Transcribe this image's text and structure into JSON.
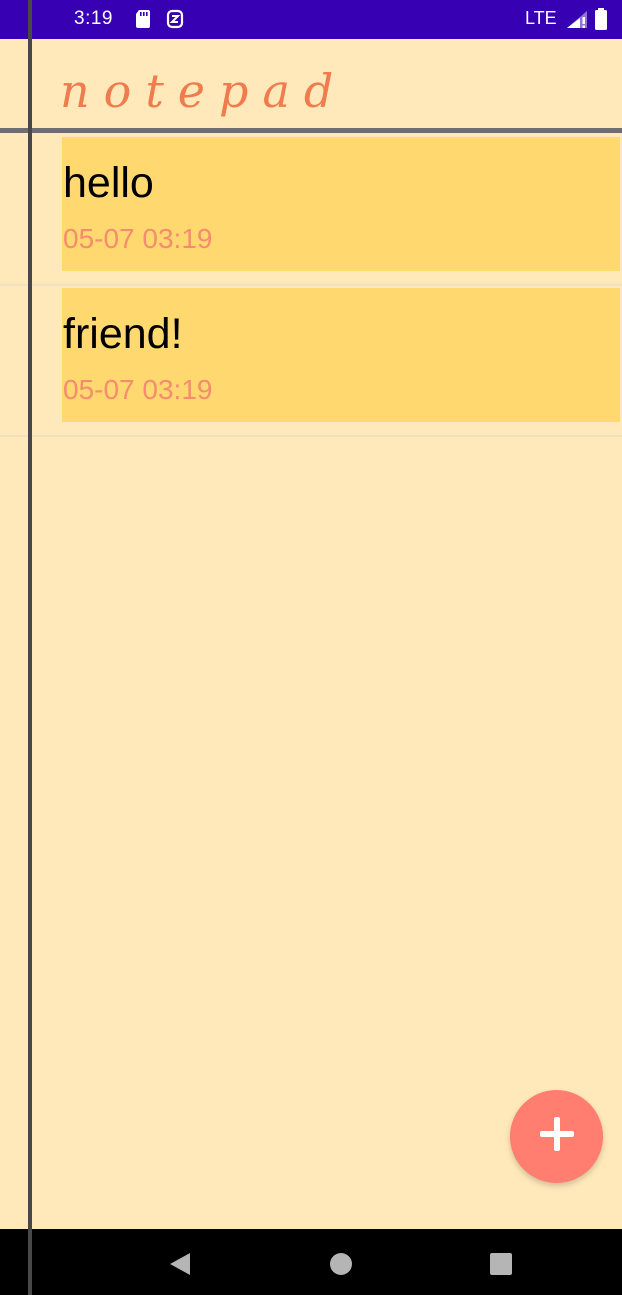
{
  "status_bar": {
    "time": "3:19",
    "network": "LTE",
    "icons": [
      "sd-card-icon",
      "notification-icon",
      "signal-icon",
      "battery-icon"
    ]
  },
  "app": {
    "title": "notepad"
  },
  "notes": [
    {
      "title": "hello",
      "time": "05-07 03:19"
    },
    {
      "title": "friend!",
      "time": "05-07 03:19"
    }
  ],
  "fab": {
    "icon": "plus-icon"
  },
  "nav_bar": {
    "buttons": [
      "back-icon",
      "home-icon",
      "recents-icon"
    ]
  },
  "colors": {
    "status_bar": "#3700B3",
    "background": "#FFE8BA",
    "note_card": "#FFD970",
    "title": "#F07C4E",
    "timestamp": "#F58C6E",
    "fab": "#FF7E70",
    "margin_line": "#484848"
  }
}
